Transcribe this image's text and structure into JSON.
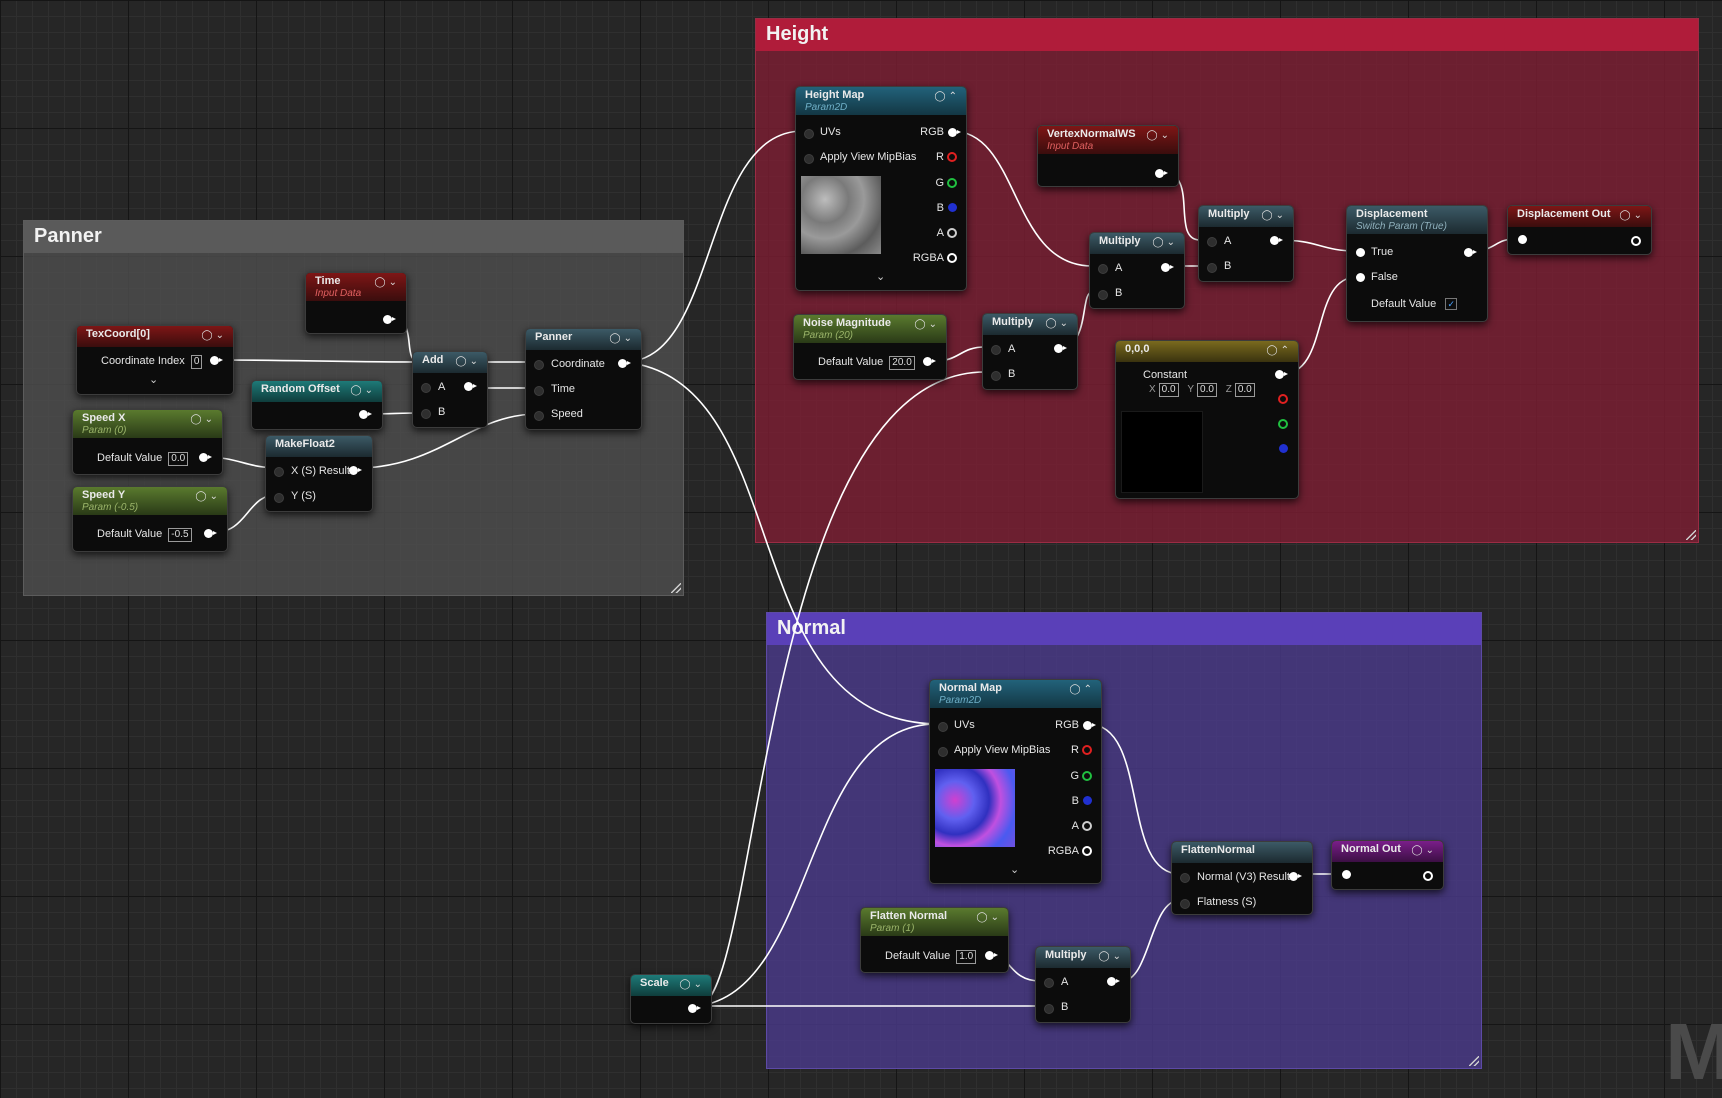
{
  "comments": {
    "height": {
      "title": "Height"
    },
    "panner": {
      "title": "Panner"
    },
    "normal": {
      "title": "Normal"
    }
  },
  "nodes": {
    "height_map": {
      "title": "Height Map",
      "subtitle": "Param2D",
      "inputs": [
        "UVs",
        "Apply View MipBias"
      ],
      "outputs": [
        "RGB",
        "R",
        "G",
        "B",
        "A",
        "RGBA"
      ]
    },
    "vertex_normal_ws": {
      "title": "VertexNormalWS",
      "subtitle": "Input Data"
    },
    "multiply_1": {
      "title": "Multiply",
      "inputs": [
        "A",
        "B"
      ]
    },
    "multiply_2": {
      "title": "Multiply",
      "inputs": [
        "A",
        "B"
      ]
    },
    "multiply_3": {
      "title": "Multiply",
      "inputs": [
        "A",
        "B"
      ]
    },
    "multiply_4": {
      "title": "Multiply",
      "inputs": [
        "A",
        "B"
      ]
    },
    "displacement": {
      "title": "Displacement",
      "subtitle": "Switch Param (True)",
      "inputs": [
        "True",
        "False"
      ],
      "default_label": "Default Value",
      "default_checked": "✓"
    },
    "displacement_out": {
      "title": "Displacement Out"
    },
    "noise_magnitude": {
      "title": "Noise Magnitude",
      "subtitle": "Param (20)",
      "default_label": "Default Value",
      "default_value": "20.0"
    },
    "constant": {
      "title": "0,0,0",
      "label": "Constant",
      "x_label": "X",
      "x": "0.0",
      "y_label": "Y",
      "y": "0.0",
      "z_label": "Z",
      "z": "0.0",
      "swatch_color": "#000000"
    },
    "time": {
      "title": "Time",
      "subtitle": "Input Data"
    },
    "texcoord": {
      "title": "TexCoord[0]",
      "label": "Coordinate Index",
      "value": "0"
    },
    "add": {
      "title": "Add",
      "inputs": [
        "A",
        "B"
      ]
    },
    "panner": {
      "title": "Panner",
      "inputs": [
        "Coordinate",
        "Time",
        "Speed"
      ]
    },
    "random_offset": {
      "title": "Random Offset"
    },
    "speed_x": {
      "title": "Speed X",
      "subtitle": "Param (0)",
      "default_label": "Default Value",
      "default_value": "0.0"
    },
    "speed_y": {
      "title": "Speed Y",
      "subtitle": "Param (-0.5)",
      "default_label": "Default Value",
      "default_value": "-0.5"
    },
    "make_float2": {
      "title": "MakeFloat2",
      "inputs": [
        "X (S)",
        "Y (S)"
      ],
      "output": "Result"
    },
    "normal_map": {
      "title": "Normal Map",
      "subtitle": "Param2D",
      "inputs": [
        "UVs",
        "Apply View MipBias"
      ],
      "outputs": [
        "RGB",
        "R",
        "G",
        "B",
        "A",
        "RGBA"
      ]
    },
    "flatten_normal": {
      "title": "FlattenNormal",
      "inputs": [
        "Normal (V3)",
        "Flatness (S)"
      ],
      "output": "Result"
    },
    "normal_out": {
      "title": "Normal Out"
    },
    "flatten_normal_param": {
      "title": "Flatten Normal",
      "subtitle": "Param (1)",
      "default_label": "Default Value",
      "default_value": "1.0"
    },
    "scale": {
      "title": "Scale"
    }
  },
  "colors": {
    "height_comment": "#7c1f33",
    "panner_comment": "#4b4b4b",
    "normal_comment": "#4a3a8a",
    "wire": "#ffffff",
    "pin_red": "#e02020",
    "pin_green": "#20c040",
    "pin_blue": "#2030d0"
  },
  "watermark": "M"
}
